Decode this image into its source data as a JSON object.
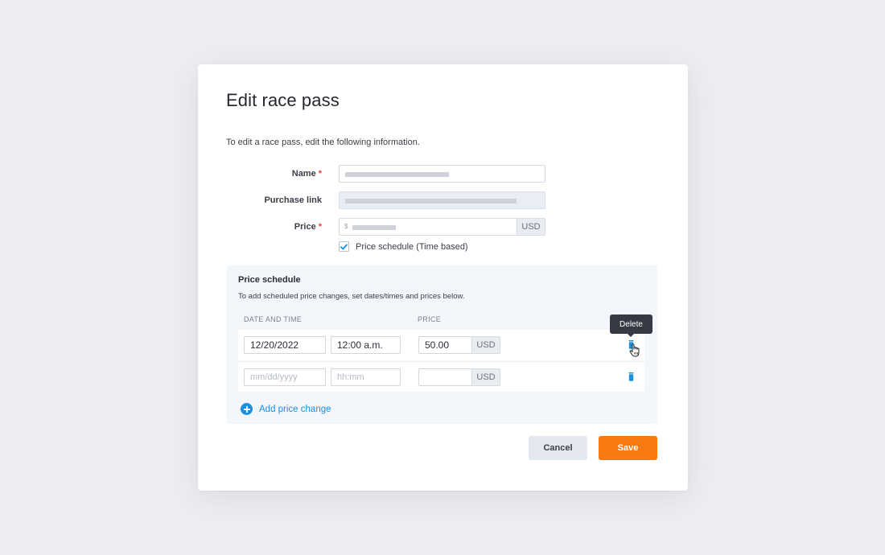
{
  "dialog": {
    "title": "Edit race pass",
    "intro": "To edit a race pass, edit the following information."
  },
  "form": {
    "name_label": "Name",
    "purchase_link_label": "Purchase link",
    "price_label": "Price",
    "required_mark": "*",
    "price_currency_symbol": "$",
    "price_currency": "USD",
    "price_schedule_checkbox_label": "Price schedule (Time based)",
    "price_schedule_checked": true
  },
  "schedule": {
    "title": "Price schedule",
    "description": "To add scheduled price changes, set dates/times and prices below.",
    "col_date_time": "DATE AND TIME",
    "col_price": "PRICE",
    "rows": [
      {
        "date": "12/20/2022",
        "time": "12:00 a.m.",
        "price": "50.00",
        "currency": "USD"
      },
      {
        "date_placeholder": "mm/dd/yyyy",
        "time_placeholder": "hh:mm",
        "price": "",
        "currency": "USD"
      }
    ],
    "add_label": "Add price change"
  },
  "tooltip": {
    "text": "Delete"
  },
  "actions": {
    "cancel": "Cancel",
    "save": "Save"
  },
  "colors": {
    "accent": "#fa7a12",
    "link": "#1b8fe0",
    "required": "#e2453c"
  }
}
